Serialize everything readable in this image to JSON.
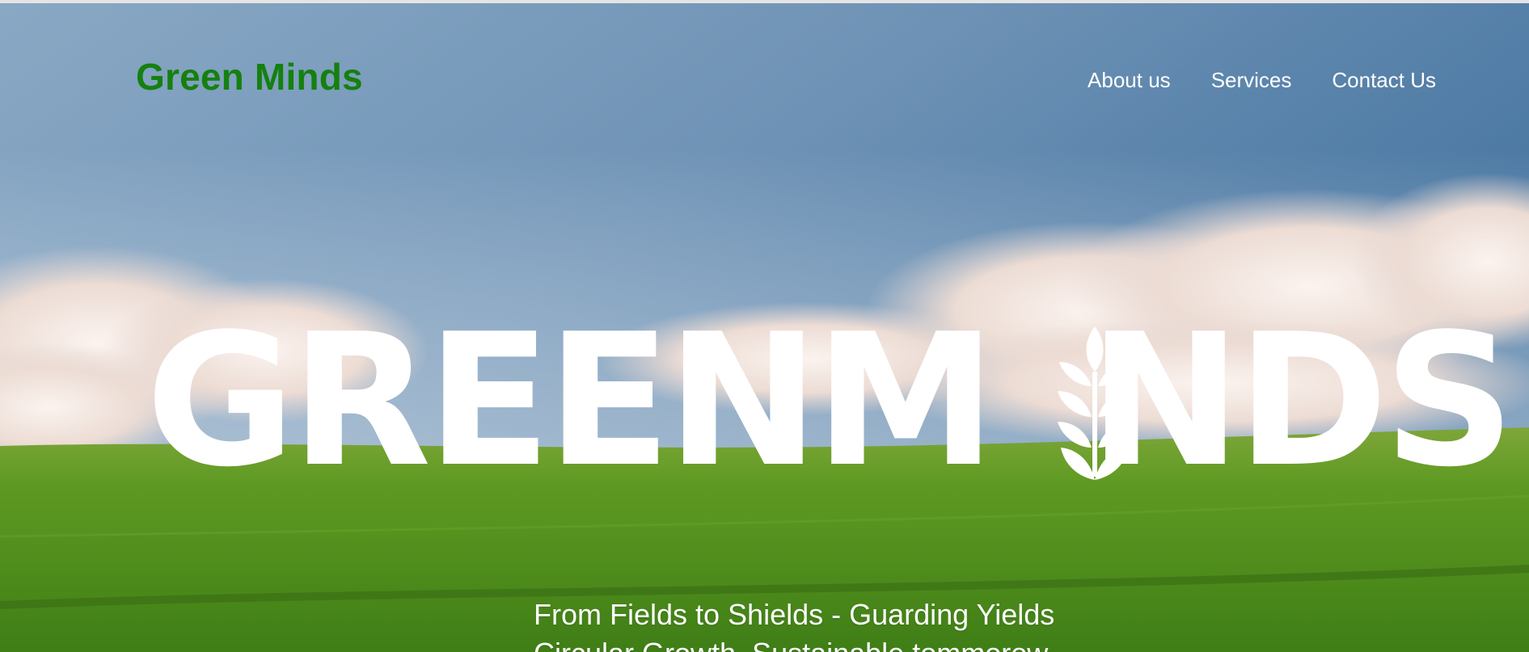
{
  "header": {
    "brand": "Green Minds",
    "nav": [
      "About us",
      "Services",
      "Contact Us"
    ]
  },
  "hero": {
    "wordmark_prefix": "GREENM",
    "wordmark_suffix": "NDS",
    "tagline_lines": [
      "From Fields to Shields - Guarding Yields",
      "Circular Growth, Sustainable tommorow"
    ]
  },
  "icons": {
    "wordmark_i": "wheat-icon"
  },
  "colors": {
    "brand": "#15800f",
    "sky_top": "#3f73a0",
    "grass": "#5e9a22"
  }
}
